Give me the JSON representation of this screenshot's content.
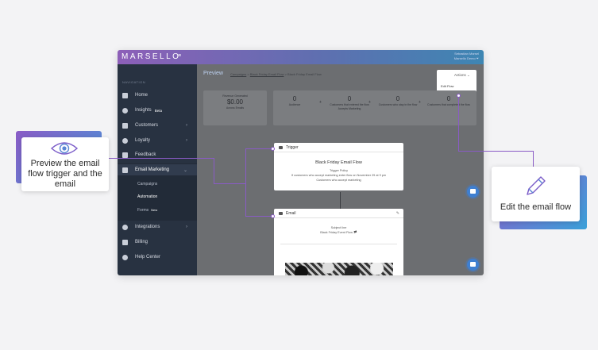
{
  "app": {
    "logo": "MARSELLO",
    "hamburger": "≡",
    "user_line1": "Sebastian Marsel",
    "user_line2": "Marsello Demo ⏷"
  },
  "sidebar": {
    "heading": "NAVIGATION",
    "items": [
      {
        "label": "Home",
        "icon": "home-icon"
      },
      {
        "label": "Insights",
        "badge": "Beta",
        "icon": "insights-icon"
      },
      {
        "label": "Customers",
        "chevron": "›",
        "icon": "customers-icon"
      },
      {
        "label": "Loyalty",
        "chevron": "›",
        "icon": "heart-icon"
      },
      {
        "label": "Feedback",
        "icon": "thumbs-up-icon"
      },
      {
        "label": "Email Marketing",
        "chevron": "⌄",
        "icon": "email-icon"
      },
      {
        "label": "Integrations",
        "chevron": "›",
        "icon": "integrations-icon"
      },
      {
        "label": "Billing",
        "icon": "card-icon"
      },
      {
        "label": "Help Center",
        "icon": "help-icon"
      }
    ],
    "subitems": [
      {
        "label": "Campaigns"
      },
      {
        "label": "Automation"
      },
      {
        "label": "Forms",
        "badge": "New"
      }
    ]
  },
  "main": {
    "title": "Preview",
    "breadcrumbs": [
      "Campaigns",
      "Black Friday Email Flow",
      "Black Friday Email Flow"
    ],
    "actions_label": "Actions ⌄",
    "actions_menu_item": "Edit Flow",
    "revenue": {
      "label": "Revenue Generated",
      "value": "$0.00",
      "sub": "Across Emails"
    },
    "stats": [
      {
        "value": "0",
        "label": "Audience"
      },
      {
        "value": "0",
        "label": "Customers that entered the flow"
      },
      {
        "value": "0",
        "label": "Customers who stay in the flow"
      },
      {
        "value": "0",
        "label": "Customers that completed the flow"
      }
    ],
    "stat_sub": "Accepts Marketing",
    "trigger_node": {
      "header": "Trigger",
      "title": "Black Friday Email Flow",
      "line1": "Trigger Policy",
      "line2": "If customers who accept marketing enter flow on November 29 at 9 pm",
      "line3": "Customers who accept marketing"
    },
    "email_node": {
      "header": "Email",
      "line1": "Subject line",
      "line2": "Black Friday Event Flow 🏴"
    }
  },
  "callouts": {
    "preview": "Preview the email flow trigger and the email",
    "edit": "Edit the email flow"
  },
  "colors": {
    "accent_purple": "#8a5bc6",
    "accent_blue": "#3aa0d8",
    "sidebar": "#283241"
  }
}
